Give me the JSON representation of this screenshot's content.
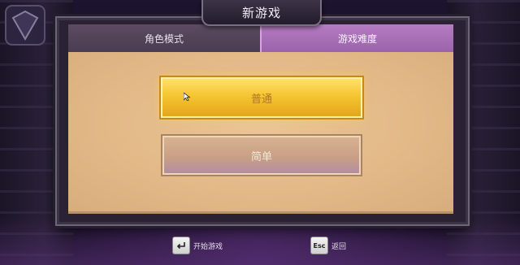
{
  "window": {
    "title": "新游戏"
  },
  "tabs": [
    {
      "label": "角色模式",
      "active": false
    },
    {
      "label": "游戏难度",
      "active": true
    }
  ],
  "difficulty": {
    "options": [
      {
        "label": "普通",
        "selected": true
      },
      {
        "label": "简单",
        "selected": false
      }
    ]
  },
  "footer": {
    "start": {
      "key_icon": "enter-key-icon",
      "label": "开始游戏"
    },
    "back": {
      "key": "Esc",
      "label": "返回"
    }
  },
  "colors": {
    "selected_button": "#f5c532",
    "active_tab": "#b57cc2",
    "panel": "#e2b987"
  }
}
